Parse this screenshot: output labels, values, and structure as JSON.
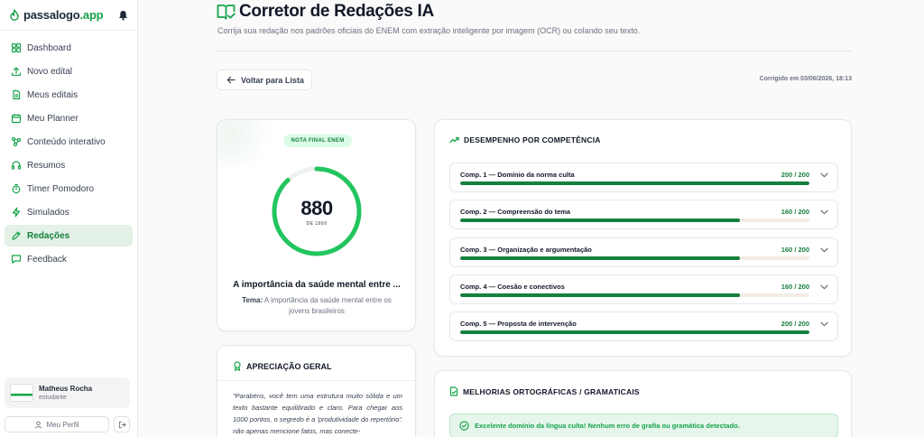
{
  "app": {
    "brand_name": "passalogo",
    "brand_tld": ".app",
    "accent": "#16a34a"
  },
  "sidebar": {
    "items": [
      {
        "label": "Dashboard",
        "icon": "dashboard-icon",
        "active": false
      },
      {
        "label": "Novo edital",
        "icon": "upload-icon",
        "active": false
      },
      {
        "label": "Meus editais",
        "icon": "document-icon",
        "active": false
      },
      {
        "label": "Meu Planner",
        "icon": "calendar-icon",
        "active": false
      },
      {
        "label": "Conteúdo interativo",
        "icon": "network-icon",
        "active": false
      },
      {
        "label": "Resumos",
        "icon": "headphones-icon",
        "active": false
      },
      {
        "label": "Timer Pomodoro",
        "icon": "timer-icon",
        "active": false
      },
      {
        "label": "Simulados",
        "icon": "lightning-icon",
        "active": false
      },
      {
        "label": "Redações",
        "icon": "pen-icon",
        "active": true
      },
      {
        "label": "Feedback",
        "icon": "chat-icon",
        "active": false
      }
    ],
    "user": {
      "name": "Matheus Rocha",
      "role": "estudante"
    },
    "profile_label": "Meu Perfil"
  },
  "header": {
    "title": "Corretor de Redações IA",
    "subtitle": "Corrija sua redação nos padrões oficiais do ENEM com extração inteligente por imagem (OCR) ou colando seu texto."
  },
  "toolbar": {
    "back_label": "Voltar para Lista",
    "corrected_at": "Corrigido em 03/06/2026, 18:13"
  },
  "score": {
    "badge": "NOTA FINAL ENEM",
    "value": "880",
    "max_label": "DE 1000",
    "fraction": 0.88,
    "essay_title": "A importância da saúde mental entre ...",
    "theme_label": "Tema:",
    "theme_text": "A importância da saúde mental entre os jovens brasileiros"
  },
  "appreciation": {
    "title": "APRECIAÇÃO GERAL",
    "text": "\"Parabéns, você tem uma estrutura muito sólida e um texto bastante equilibrado e claro. Para chegar aos 1000 pontos, o segredo é a 'produtividade do repertório': não apenas mencione fatos, mas conecte-"
  },
  "competencies": {
    "title": "DESEMPENHO POR COMPETÊNCIA",
    "items": [
      {
        "label": "Comp. 1 — Domínio da norma culta",
        "score": "200 / 200",
        "fraction": 1.0
      },
      {
        "label": "Comp. 2 — Compreensão do tema",
        "score": "160 / 200",
        "fraction": 0.8
      },
      {
        "label": "Comp. 3 — Organização e argumentação",
        "score": "160 / 200",
        "fraction": 0.8
      },
      {
        "label": "Comp. 4 — Coesão e conectivos",
        "score": "160 / 200",
        "fraction": 0.8
      },
      {
        "label": "Comp. 5 — Proposta de intervenção",
        "score": "200 / 200",
        "fraction": 1.0
      }
    ]
  },
  "improvements": {
    "title": "MELHORIAS ORTOGRÁFICAS / GRAMATICAIS",
    "ok_message": "Excelente domínio da língua culta! Nenhum erro de grafia ou gramática detectado."
  }
}
